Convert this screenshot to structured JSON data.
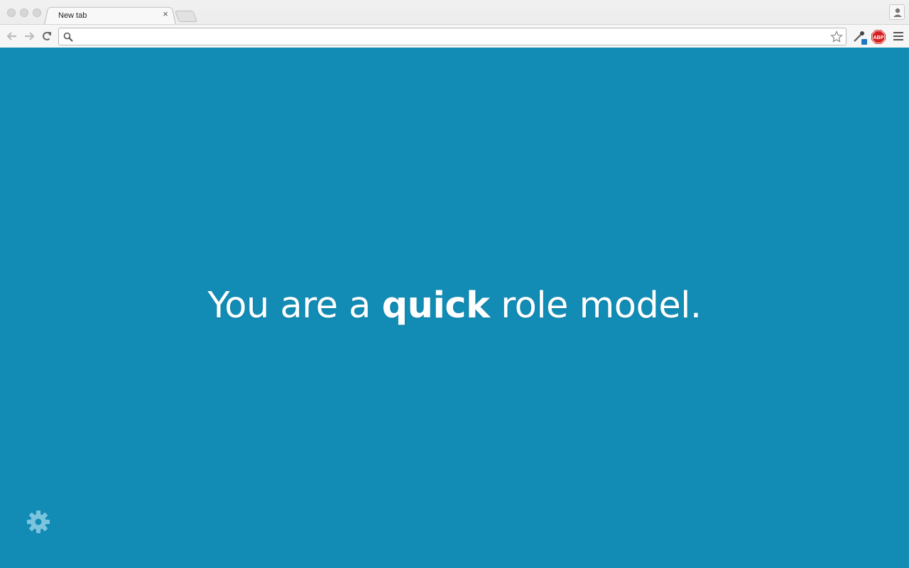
{
  "browser": {
    "tab": {
      "title": "New tab",
      "close": "×"
    },
    "omnibox": {
      "value": "",
      "placeholder": ""
    },
    "extensions": [
      {
        "name": "eyedropper-icon"
      },
      {
        "name": "adblock-plus-icon",
        "label": "ABP"
      }
    ]
  },
  "page": {
    "background": "#128cb5",
    "message": {
      "before": "You are a ",
      "emphasis": "quick",
      "after": " role model."
    }
  },
  "colors": {
    "abp_red": "#d42020",
    "text": "#ffffff"
  }
}
